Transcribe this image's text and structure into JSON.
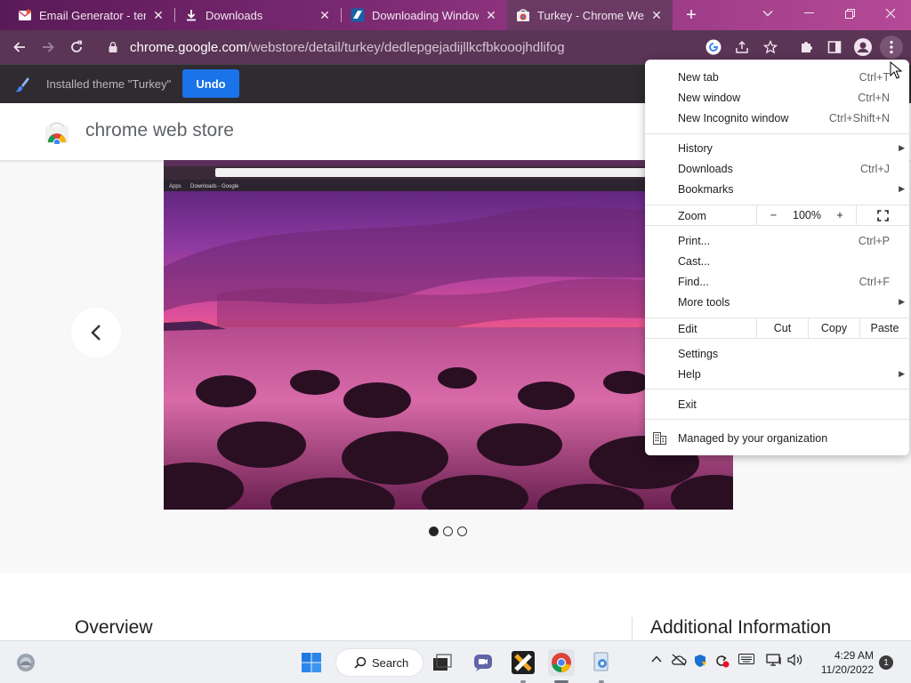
{
  "browser": {
    "tabs": [
      {
        "title": "Email Generator - temp",
        "favicon": "mail-icon"
      },
      {
        "title": "Downloads",
        "favicon": "download-icon"
      },
      {
        "title": "Downloading Windows",
        "favicon": "site-logo-icon"
      },
      {
        "title": "Turkey - Chrome Web Store",
        "favicon": "chrome-web-store-icon"
      }
    ],
    "url_host": "chrome.google.com",
    "url_path": "/webstore/detail/turkey/dedlepgejadijllkcfbkooojhdlifog",
    "colors": {
      "frame": "#7b2a72",
      "toolbar": "#5a3556",
      "accent": "#1a73e8"
    }
  },
  "infobar": {
    "message": "Installed theme \"Turkey\"",
    "undo_label": "Undo"
  },
  "store": {
    "title": "chrome web store",
    "overview_heading": "Overview",
    "additional_heading": "Additional Information",
    "preview": {
      "apps_label": "Apps",
      "bookmark_label": "Downloads - Google"
    },
    "carousel": {
      "total": 3,
      "current": 1
    }
  },
  "menu": {
    "new_tab": {
      "label": "New tab",
      "shortcut": "Ctrl+T"
    },
    "new_window": {
      "label": "New window",
      "shortcut": "Ctrl+N"
    },
    "new_incognito": {
      "label": "New Incognito window",
      "shortcut": "Ctrl+Shift+N"
    },
    "history": {
      "label": "History"
    },
    "downloads": {
      "label": "Downloads",
      "shortcut": "Ctrl+J"
    },
    "bookmarks": {
      "label": "Bookmarks"
    },
    "zoom": {
      "label": "Zoom",
      "minus": "−",
      "value": "100%",
      "plus": "+"
    },
    "print": {
      "label": "Print...",
      "shortcut": "Ctrl+P"
    },
    "cast": {
      "label": "Cast..."
    },
    "find": {
      "label": "Find...",
      "shortcut": "Ctrl+F"
    },
    "more_tools": {
      "label": "More tools"
    },
    "edit": {
      "label": "Edit",
      "cut": "Cut",
      "copy": "Copy",
      "paste": "Paste"
    },
    "settings": {
      "label": "Settings"
    },
    "help": {
      "label": "Help"
    },
    "exit": {
      "label": "Exit"
    },
    "managed": {
      "label": "Managed by your organization"
    }
  },
  "taskbar": {
    "search_label": "Search",
    "time": "4:29 AM",
    "date": "11/20/2022",
    "notifications": "1"
  }
}
